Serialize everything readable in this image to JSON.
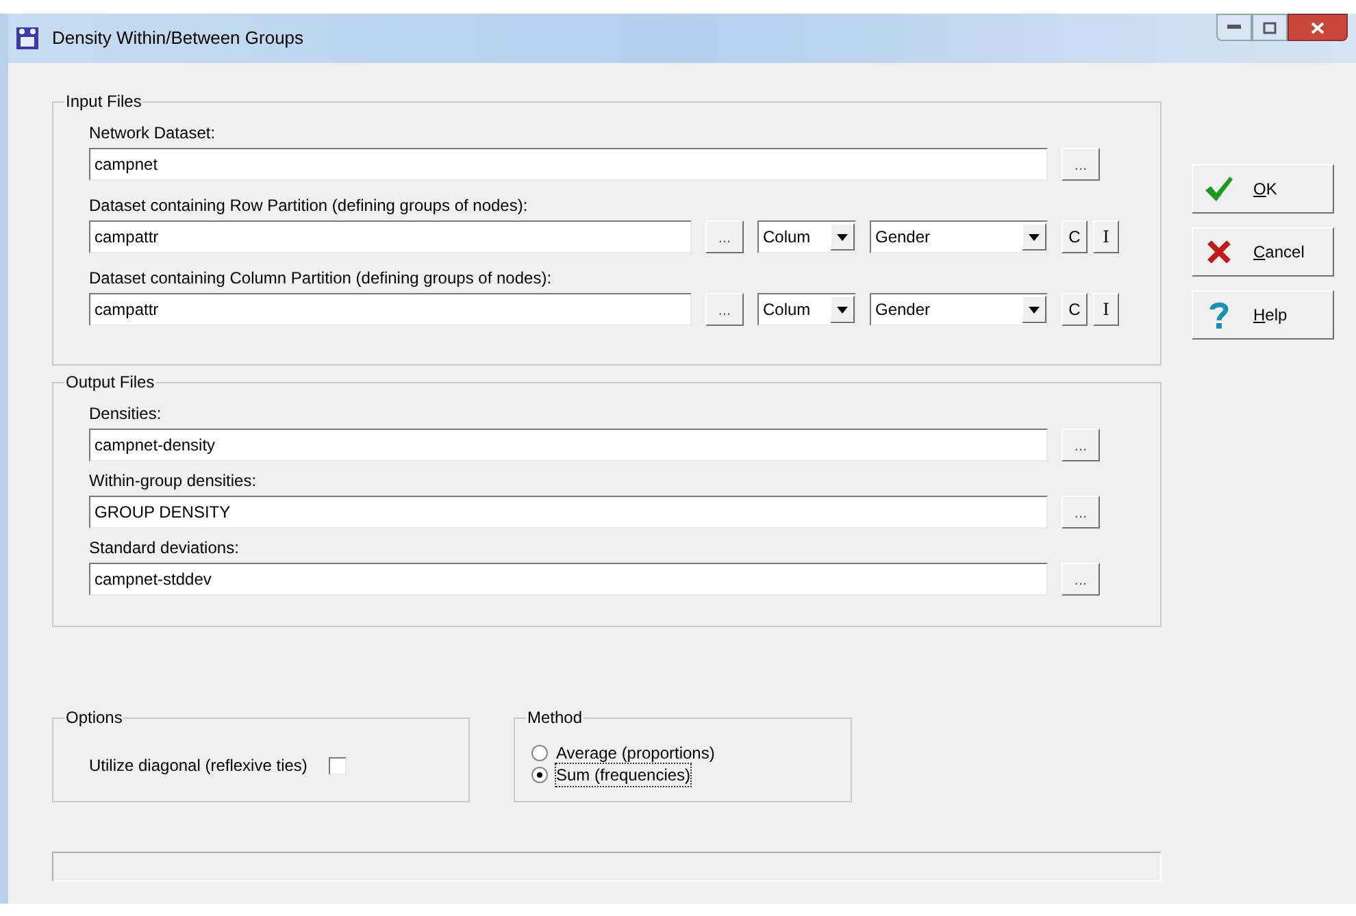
{
  "window": {
    "title": "Density Within/Between Groups"
  },
  "input_files": {
    "title": "Input Files",
    "fields": [
      {
        "kind": "file",
        "label": "Network Dataset:",
        "value": "campnet",
        "browse": "..."
      },
      {
        "kind": "partition",
        "label": "Dataset containing Row Partition (defining groups of nodes):",
        "value": "campattr",
        "browse": "...",
        "orientation": "Colum",
        "attribute": "Gender",
        "c_button": "C",
        "i_button": "I"
      },
      {
        "kind": "partition",
        "label": "Dataset containing Column Partition (defining groups of nodes):",
        "value": "campattr",
        "browse": "...",
        "orientation": "Colum",
        "attribute": "Gender",
        "c_button": "C",
        "i_button": "I"
      }
    ]
  },
  "output_files": {
    "title": "Output Files",
    "fields": [
      {
        "kind": "file",
        "label": "Densities:",
        "value": "campnet-density",
        "browse": "..."
      },
      {
        "kind": "file",
        "label": "Within-group densities:",
        "value": "GROUP DENSITY",
        "browse": "..."
      },
      {
        "kind": "file",
        "label": "Standard deviations:",
        "value": "campnet-stddev",
        "browse": "..."
      }
    ]
  },
  "options": {
    "title": "Options",
    "checkboxes": [
      {
        "label": "Utilize diagonal (reflexive ties)",
        "checked": false
      }
    ]
  },
  "method": {
    "title": "Method",
    "options": [
      {
        "label": "Average (proportions)",
        "selected": false
      },
      {
        "label": "Sum (frequencies)",
        "selected": true
      }
    ]
  },
  "buttons": [
    {
      "kind": "ok",
      "label": "OK"
    },
    {
      "kind": "cancel",
      "label": "Cancel"
    },
    {
      "kind": "help",
      "label": "Help"
    }
  ]
}
